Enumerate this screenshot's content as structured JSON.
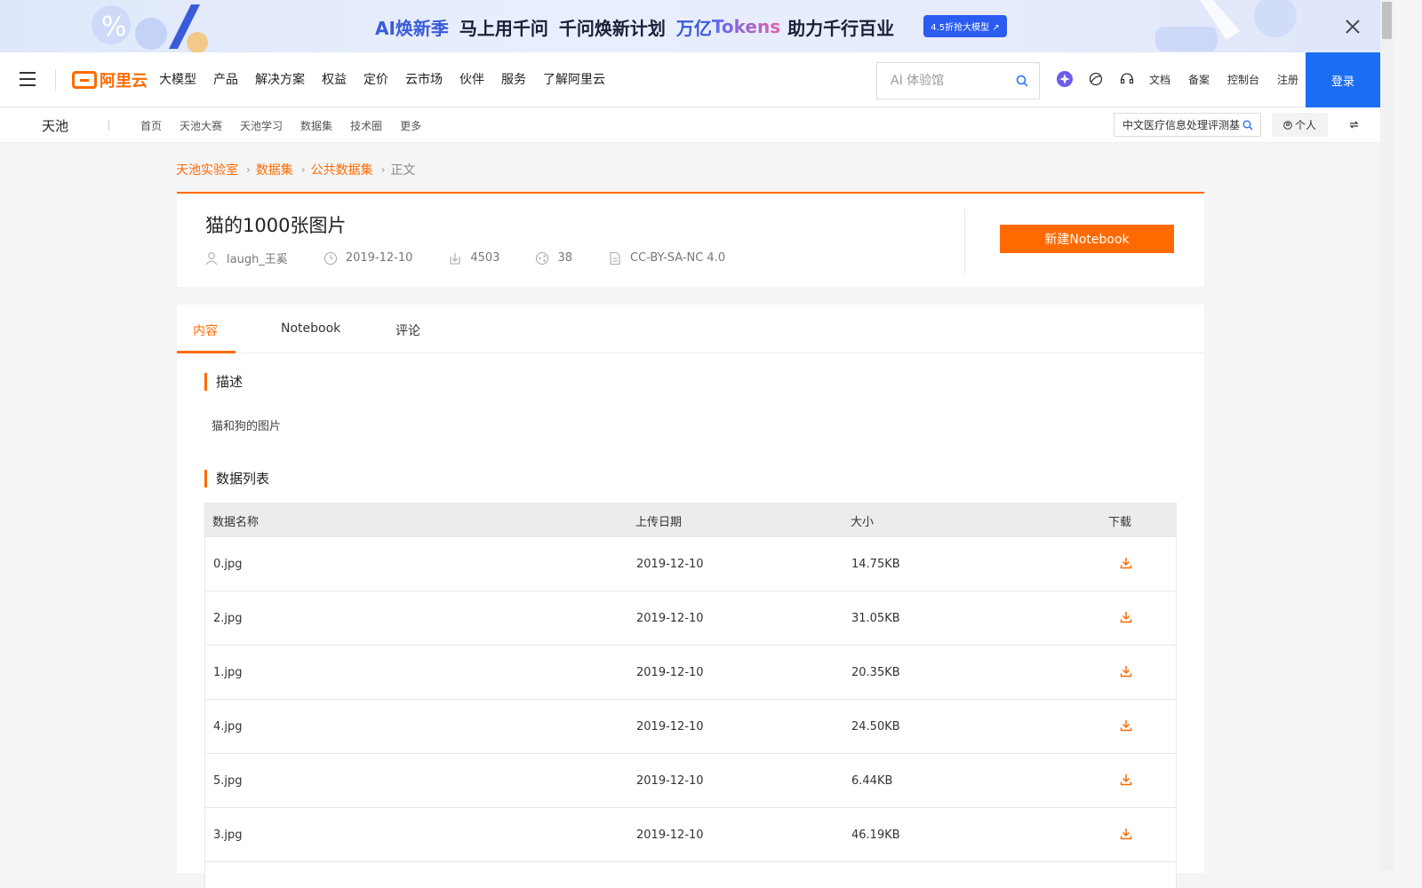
{
  "banner": {
    "ai": "AI焕新季",
    "text1": "马上用千问",
    "text2": "千问焕新计划",
    "text3_blue": "万亿",
    "text3_grad": "Tokens",
    "text4": "助力千行百业",
    "button": "4.5折抢大模型 ↗"
  },
  "nav": {
    "logo": "阿里云",
    "items": [
      "大模型",
      "产品",
      "解决方案",
      "权益",
      "定价",
      "云市场",
      "伙伴",
      "服务",
      "了解阿里云"
    ],
    "search_placeholder": "AI 体验馆",
    "right_links": [
      "文档",
      "备案",
      "控制台",
      "注册"
    ],
    "login": "登录"
  },
  "subnav": {
    "brand": "天池",
    "links": [
      "首页",
      "天池大赛",
      "天池学习",
      "数据集",
      "技术圈",
      "更多"
    ],
    "search_value": "中文医疗信息处理评测基",
    "personal": "个人"
  },
  "breadcrumb": [
    "天池实验室",
    "数据集",
    "公共数据集",
    "正文"
  ],
  "dataset": {
    "title": "猫的1000张图片",
    "author": "laugh_王奚",
    "date": "2019-12-10",
    "downloads": "4503",
    "shares": "38",
    "license": "CC-BY-SA-NC 4.0",
    "new_notebook": "新建Notebook"
  },
  "tabs": [
    "内容",
    "Notebook",
    "评论"
  ],
  "description": {
    "title": "描述",
    "text": "猫和狗的图片"
  },
  "data_list": {
    "title": "数据列表",
    "headers": [
      "数据名称",
      "上传日期",
      "大小",
      "下载"
    ],
    "rows": [
      {
        "name": "0.jpg",
        "date": "2019-12-10",
        "size": "14.75KB"
      },
      {
        "name": "2.jpg",
        "date": "2019-12-10",
        "size": "31.05KB"
      },
      {
        "name": "1.jpg",
        "date": "2019-12-10",
        "size": "20.35KB"
      },
      {
        "name": "4.jpg",
        "date": "2019-12-10",
        "size": "24.50KB"
      },
      {
        "name": "5.jpg",
        "date": "2019-12-10",
        "size": "6.44KB"
      },
      {
        "name": "3.jpg",
        "date": "2019-12-10",
        "size": "46.19KB"
      }
    ]
  },
  "colors": {
    "accent": "#ff6a00",
    "login": "#1b6ef3"
  }
}
